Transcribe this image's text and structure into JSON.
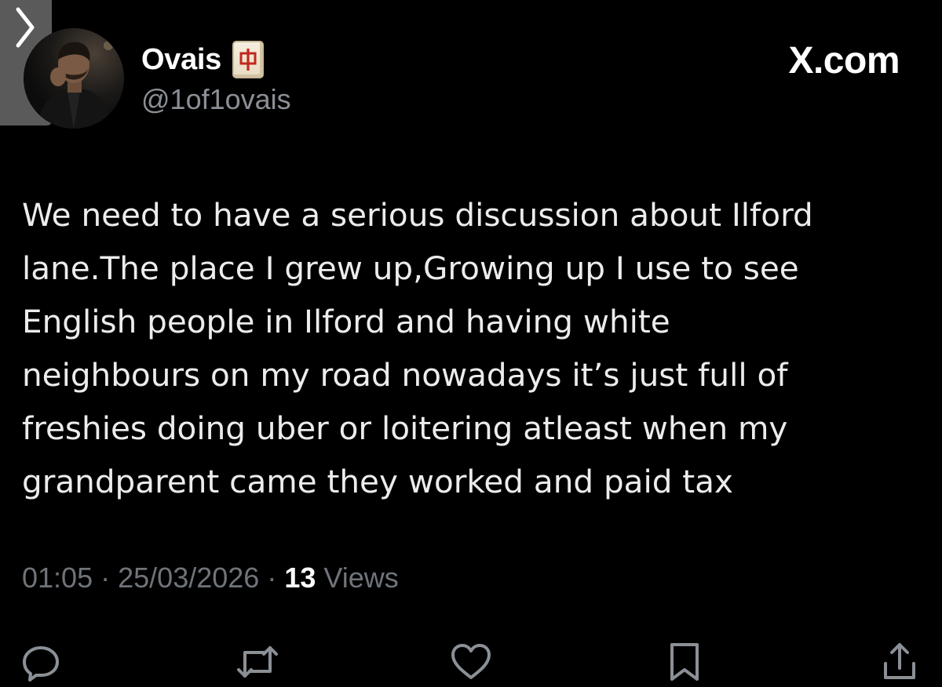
{
  "author": {
    "display_name": "Ovais",
    "badge_icon": "mahjong-red-dragon-icon",
    "handle": "@1of1ovais"
  },
  "brand": "X.com",
  "tweet": {
    "lines": [
      "We need to have a serious discussion about Ilford",
      "lane.The place I grew up,Growing up I use to see",
      "English people in Ilford and having white",
      "neighbours on my road nowadays it’s just full of",
      "freshies doing uber or loitering atleast when my",
      "grandparent came they worked and paid tax"
    ]
  },
  "meta": {
    "time": "01:05",
    "separator": "·",
    "date": "25/03/2026",
    "views_count": "13",
    "views_label": "Views"
  },
  "actions": [
    "reply-icon",
    "repost-icon",
    "like-icon",
    "bookmark-icon",
    "share-icon"
  ],
  "colors": {
    "background": "#000000",
    "text": "#e7e9ea",
    "muted": "#6f747a",
    "icon": "#8b9096"
  }
}
